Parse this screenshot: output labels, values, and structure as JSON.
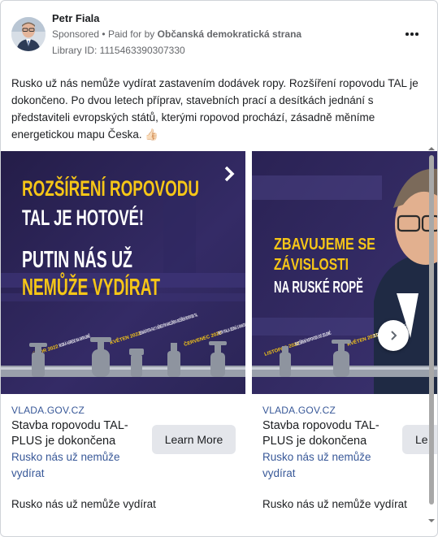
{
  "post": {
    "page_name": "Petr Fiala",
    "sponsored_label": "Sponsored",
    "paid_for_prefix": "Paid for by",
    "paid_for_by": "Občanská demokratická strana",
    "library_id": "Library ID: 1115463390307330",
    "body": "Rusko už nás nemůže vydírat zastavením dodávek ropy. Rozšíření ropovodu TAL je dokončeno. Po dvou letech příprav, stavebních prací a desítkách jednání s představiteli evropských států, kterými ropovod prochází, zásadně měníme energetickou mapu Česka. 👍🏻"
  },
  "cards": [
    {
      "image": {
        "line1": "ROZŠÍŘENÍ ROPOVODU",
        "line2": "TAL JE HOTOVÉ!",
        "line3": "PUTIN NÁS UŽ",
        "line4": "NEMŮŽE VYDÍRAT",
        "timeline": [
          {
            "date": "ÚNOR 2022",
            "text": "RUSKÁ AGRESE NA UKRAJINĚ"
          },
          {
            "date": "KVĚTEN 2022",
            "text": "JEDNÁNÍ PETRA FIALY S NĚMECKÝM KANCLÉŘEM A ROZŠÍŘENÍ ROPOVODU TAL"
          },
          {
            "date": "ČERVENEC 2022",
            "text": "PETR FIALA JEDNÁ S RAKOUSKÝM PREMIÉREM"
          }
        ]
      },
      "domain": "VLADA.GOV.CZ",
      "title": "Stavba ropovodu TAL-PLUS je dokončena",
      "description": "Rusko nás už nemůže vydírat",
      "cta": "Learn More",
      "footer": "Rusko nás už nemůže vydírat"
    },
    {
      "image": {
        "line1": "ZBAVUJEME SE",
        "line2": "ZÁVISLOSTI",
        "line3": "NA RUSKÉ ROPĚ",
        "timeline": [
          {
            "date": "LISTOPAD 2022",
            "text": "ROZŠÍŘENÍ ROPOVODU DO ZELENIČ"
          },
          {
            "date": "KVĚTEN 2023",
            "text": "S DOBUDOVÁNÍM MEZI..."
          }
        ]
      },
      "domain": "VLADA.GOV.CZ",
      "title": "Stavba ropovodu TAL-PLUS je dokončena",
      "description": "Rusko nás už nemůže vydírat",
      "cta": "Le",
      "footer": "Rusko nás už nemůže vydírat"
    }
  ],
  "colors": {
    "ad_bg_dark": "#2a2352",
    "ad_bg_purple": "#3b3270",
    "ad_yellow": "#f6c617",
    "ad_white": "#ffffff",
    "link_blue": "#385898",
    "muted": "#65676b",
    "button_gray": "#e4e6eb"
  },
  "icons": {
    "more": "more-horizontal-icon",
    "next": "chevron-right-icon",
    "slide_next": "chevron-right-icon"
  }
}
